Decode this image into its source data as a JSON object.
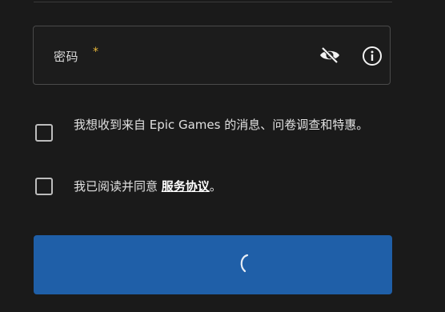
{
  "password_field": {
    "label": "密码",
    "required_mark": "*"
  },
  "icons": {
    "visibility_toggle": "eye-off-icon",
    "info": "info-icon",
    "loading": "loading-spinner-icon"
  },
  "consent": {
    "marketing_text": "我想收到来自 Epic Games 的消息、问卷调查和特惠。",
    "terms_prefix": "我已阅读并同意 ",
    "terms_link": "服务协议",
    "terms_suffix": "。"
  },
  "colors": {
    "background": "#1a1a1a",
    "accent_button": "#1f5fa8",
    "required": "#e8b73a"
  }
}
